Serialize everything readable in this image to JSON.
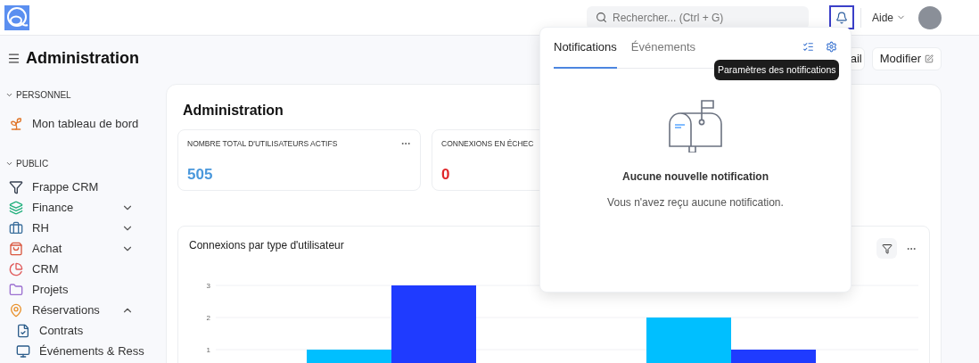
{
  "topbar": {
    "search": {
      "placeholder": "Rechercher... (Ctrl + G)"
    },
    "bell": {
      "focused": true
    },
    "help": "Aide"
  },
  "page": {
    "title": "Administration",
    "actions": [
      {
        "label": "ail",
        "kind": "plain"
      },
      {
        "label": "Modifier",
        "kind": "edit"
      }
    ]
  },
  "sidebar": {
    "sections": [
      {
        "title": "PERSONNEL",
        "expanded": true,
        "items": [
          {
            "label": "Mon tableau de bord"
          }
        ]
      },
      {
        "title": "PUBLIC",
        "expanded": true,
        "items": [
          {
            "label": "Frappe CRM"
          },
          {
            "label": "Finance",
            "expanded": false
          },
          {
            "label": "RH",
            "expanded": false
          },
          {
            "label": "Achat",
            "expanded": false
          },
          {
            "label": "CRM"
          },
          {
            "label": "Projets"
          },
          {
            "label": "Réservations",
            "expanded": true,
            "children": [
              {
                "label": "Contrats"
              },
              {
                "label": "Événements & Ress"
              }
            ]
          }
        ]
      }
    ]
  },
  "workspace": {
    "title": "Administration",
    "number_cards": [
      {
        "label": "NOMBRE TOTAL D'UTILISATEURS ACTIFS",
        "value": "505",
        "color": "#4a98dc"
      },
      {
        "label": "CONNEXIONS EN ÉCHEC",
        "value": "0",
        "color": "#e0262a"
      }
    ],
    "chart": {
      "chart_data": {
        "type": "bar",
        "title": "Connexions par type d'utilisateur",
        "ylim": [
          0,
          3
        ],
        "yticks": [
          1,
          2,
          3
        ],
        "series": [
          {
            "color": "#00bfff",
            "values": [
              1,
              2
            ]
          },
          {
            "color": "#1f3bff",
            "values": [
              3,
              1
            ]
          }
        ]
      }
    }
  },
  "notifications": {
    "tabs": [
      {
        "label": "Notifications",
        "selected": true
      },
      {
        "label": "Événements",
        "selected": false
      }
    ],
    "tooltip": "Paramètres des notifications",
    "empty_title": "Aucune nouvelle notification",
    "empty_text": "Vous n'avez reçu aucune notification."
  }
}
